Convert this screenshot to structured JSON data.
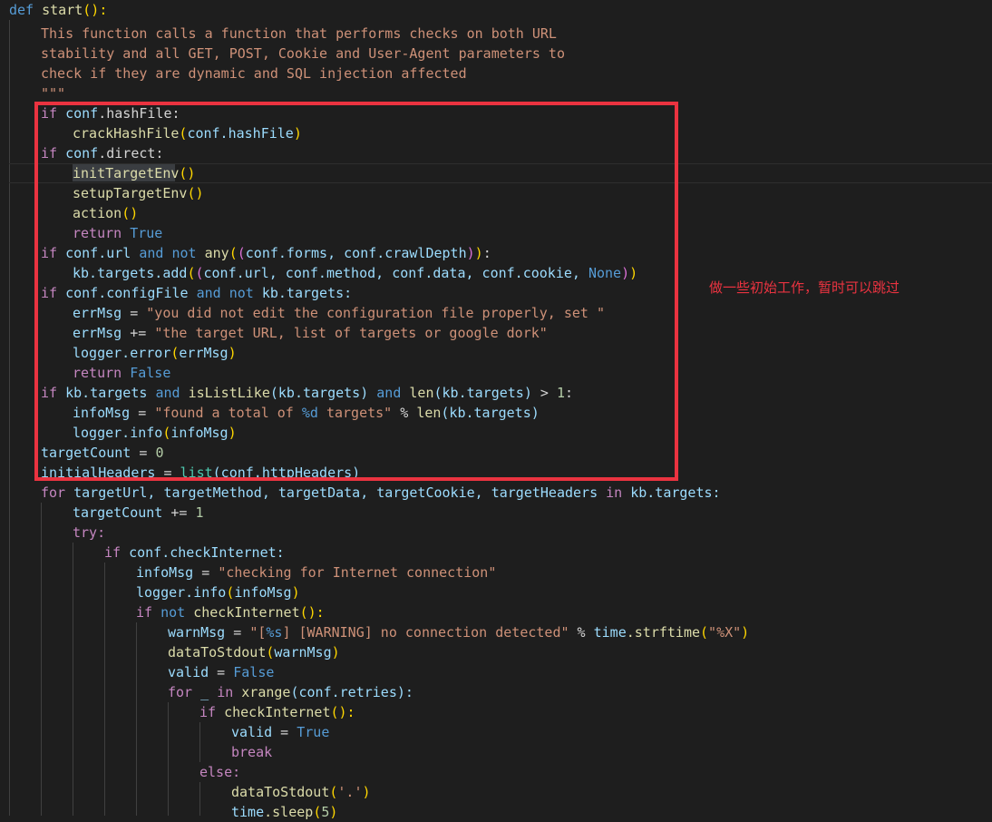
{
  "code": {
    "l01": {
      "def": "def",
      "name": "start",
      "paren": "():"
    },
    "l02": "This function calls a function that performs checks on both URL",
    "l03": "stability and all GET, POST, Cookie and User-Agent parameters to",
    "l04": "check if they are dynamic and SQL injection affected",
    "l05": "\"\"\"",
    "l06": {
      "if": "if",
      "conf": "conf",
      "attr": ".hashFile:"
    },
    "l07": {
      "fn": "crackHashFile",
      "open": "(",
      "arg": "conf.hashFile",
      "close": ")"
    },
    "l08": {
      "if": "if",
      "conf": "conf",
      "attr": ".direct:"
    },
    "l09": {
      "fn": "initTargetEnv",
      "parens": "()"
    },
    "l10": {
      "fn": "setupTargetEnv",
      "parens": "()"
    },
    "l11": {
      "fn": "action",
      "parens": "()"
    },
    "l12": {
      "ret": "return",
      "val": "True"
    },
    "l13": {
      "if": "if",
      "conf": "conf.url",
      "and": "and",
      "not": "not",
      "fn": "any",
      "o1": "(",
      "o2": "(",
      "a1": "conf.forms, conf.crawlDepth",
      "c2": ")",
      "c1": ")",
      "colon": ":"
    },
    "l14": {
      "kb": "kb.targets.add",
      "o1": "(",
      "o2": "(",
      "args": "conf.url, conf.method, conf.data, conf.cookie, ",
      "none": "None",
      "c2": ")",
      "c1": ")"
    },
    "l15": {
      "if": "if",
      "conf": "conf.configFile",
      "and": "and",
      "not": "not",
      "kb": "kb.targets:"
    },
    "l16": {
      "var": "errMsg",
      "op": " = ",
      "str": "\"you did not edit the configuration file properly, set \""
    },
    "l17": {
      "var": "errMsg",
      "op": " += ",
      "str": "\"the target URL, list of targets or google dork\""
    },
    "l18": {
      "obj": "logger.error",
      "open": "(",
      "arg": "errMsg",
      "close": ")"
    },
    "l19": {
      "ret": "return",
      "val": "False"
    },
    "l20": {
      "if": "if",
      "kb": "kb.targets",
      "and": "and",
      "fn": "isListLike",
      "a": "(kb.targets)",
      "and2": "and",
      "len": "len",
      "b": "(kb.targets)",
      "gt": " > ",
      "num": "1",
      "colon": ":"
    },
    "l21": {
      "var": "infoMsg",
      "op": " = ",
      "str": "\"found a total of ",
      "fmt": "%d",
      "str2": " targets\"",
      "pct": " % ",
      "len": "len",
      "arg": "(kb.targets)"
    },
    "l22": {
      "obj": "logger.info",
      "open": "(",
      "arg": "infoMsg",
      "close": ")"
    },
    "l23": {
      "var": "targetCount",
      "op": " = ",
      "num": "0"
    },
    "l24": {
      "var": "initialHeaders",
      "op": " = ",
      "fn": "list",
      "arg": "(conf.httpHeaders)"
    },
    "l25": {
      "for": "for",
      "vars": "targetUrl, targetMethod, targetData, targetCookie, targetHeaders",
      "in": "in",
      "kb": "kb.targets:"
    },
    "l26": {
      "var": "targetCount",
      "op": " += ",
      "num": "1"
    },
    "l27": {
      "try": "try:"
    },
    "l28": {
      "if": "if",
      "conf": "conf.checkInternet:"
    },
    "l29": {
      "var": "infoMsg",
      "op": " = ",
      "str": "\"checking for Internet connection\""
    },
    "l30": {
      "obj": "logger.info",
      "open": "(",
      "arg": "infoMsg",
      "close": ")"
    },
    "l31": {
      "if": "if",
      "not": "not",
      "fn": "checkInternet",
      "parens": "():"
    },
    "l32": {
      "var": "warnMsg",
      "op": " = ",
      "str": "\"[",
      "fmt": "%s",
      "str2": "] [WARNING] no connection detected\"",
      "pct": " % ",
      "mod": "time",
      "fn": ".strftime",
      "open": "(",
      "arg": "\"%X\"",
      "close": ")"
    },
    "l33": {
      "fn": "dataToStdout",
      "open": "(",
      "arg": "warnMsg",
      "close": ")"
    },
    "l34": {
      "var": "valid",
      "op": " = ",
      "val": "False"
    },
    "l35": {
      "for": "for",
      "us": "_",
      "in": "in",
      "fn": "xrange",
      "arg": "(conf.retries):"
    },
    "l36": {
      "if": "if",
      "fn": "checkInternet",
      "parens": "():"
    },
    "l37": {
      "var": "valid",
      "op": " = ",
      "val": "True"
    },
    "l38": {
      "brk": "break"
    },
    "l39": {
      "else": "else:"
    },
    "l40": {
      "fn": "dataToStdout",
      "open": "(",
      "arg": "'.'",
      "close": ")"
    },
    "l41": {
      "mod": "time",
      "fn": ".sleep",
      "open": "(",
      "num": "5",
      "close": ")"
    }
  },
  "annotation": {
    "note": "做一些初始工作，暂时可以跳过",
    "color": "#ea3340"
  },
  "theme": {
    "background": "#1e1e1e",
    "keyword": "#569cd6",
    "control": "#c586c0",
    "function": "#dcdcaa",
    "variable": "#9cdcfe",
    "string": "#ce9178"
  }
}
